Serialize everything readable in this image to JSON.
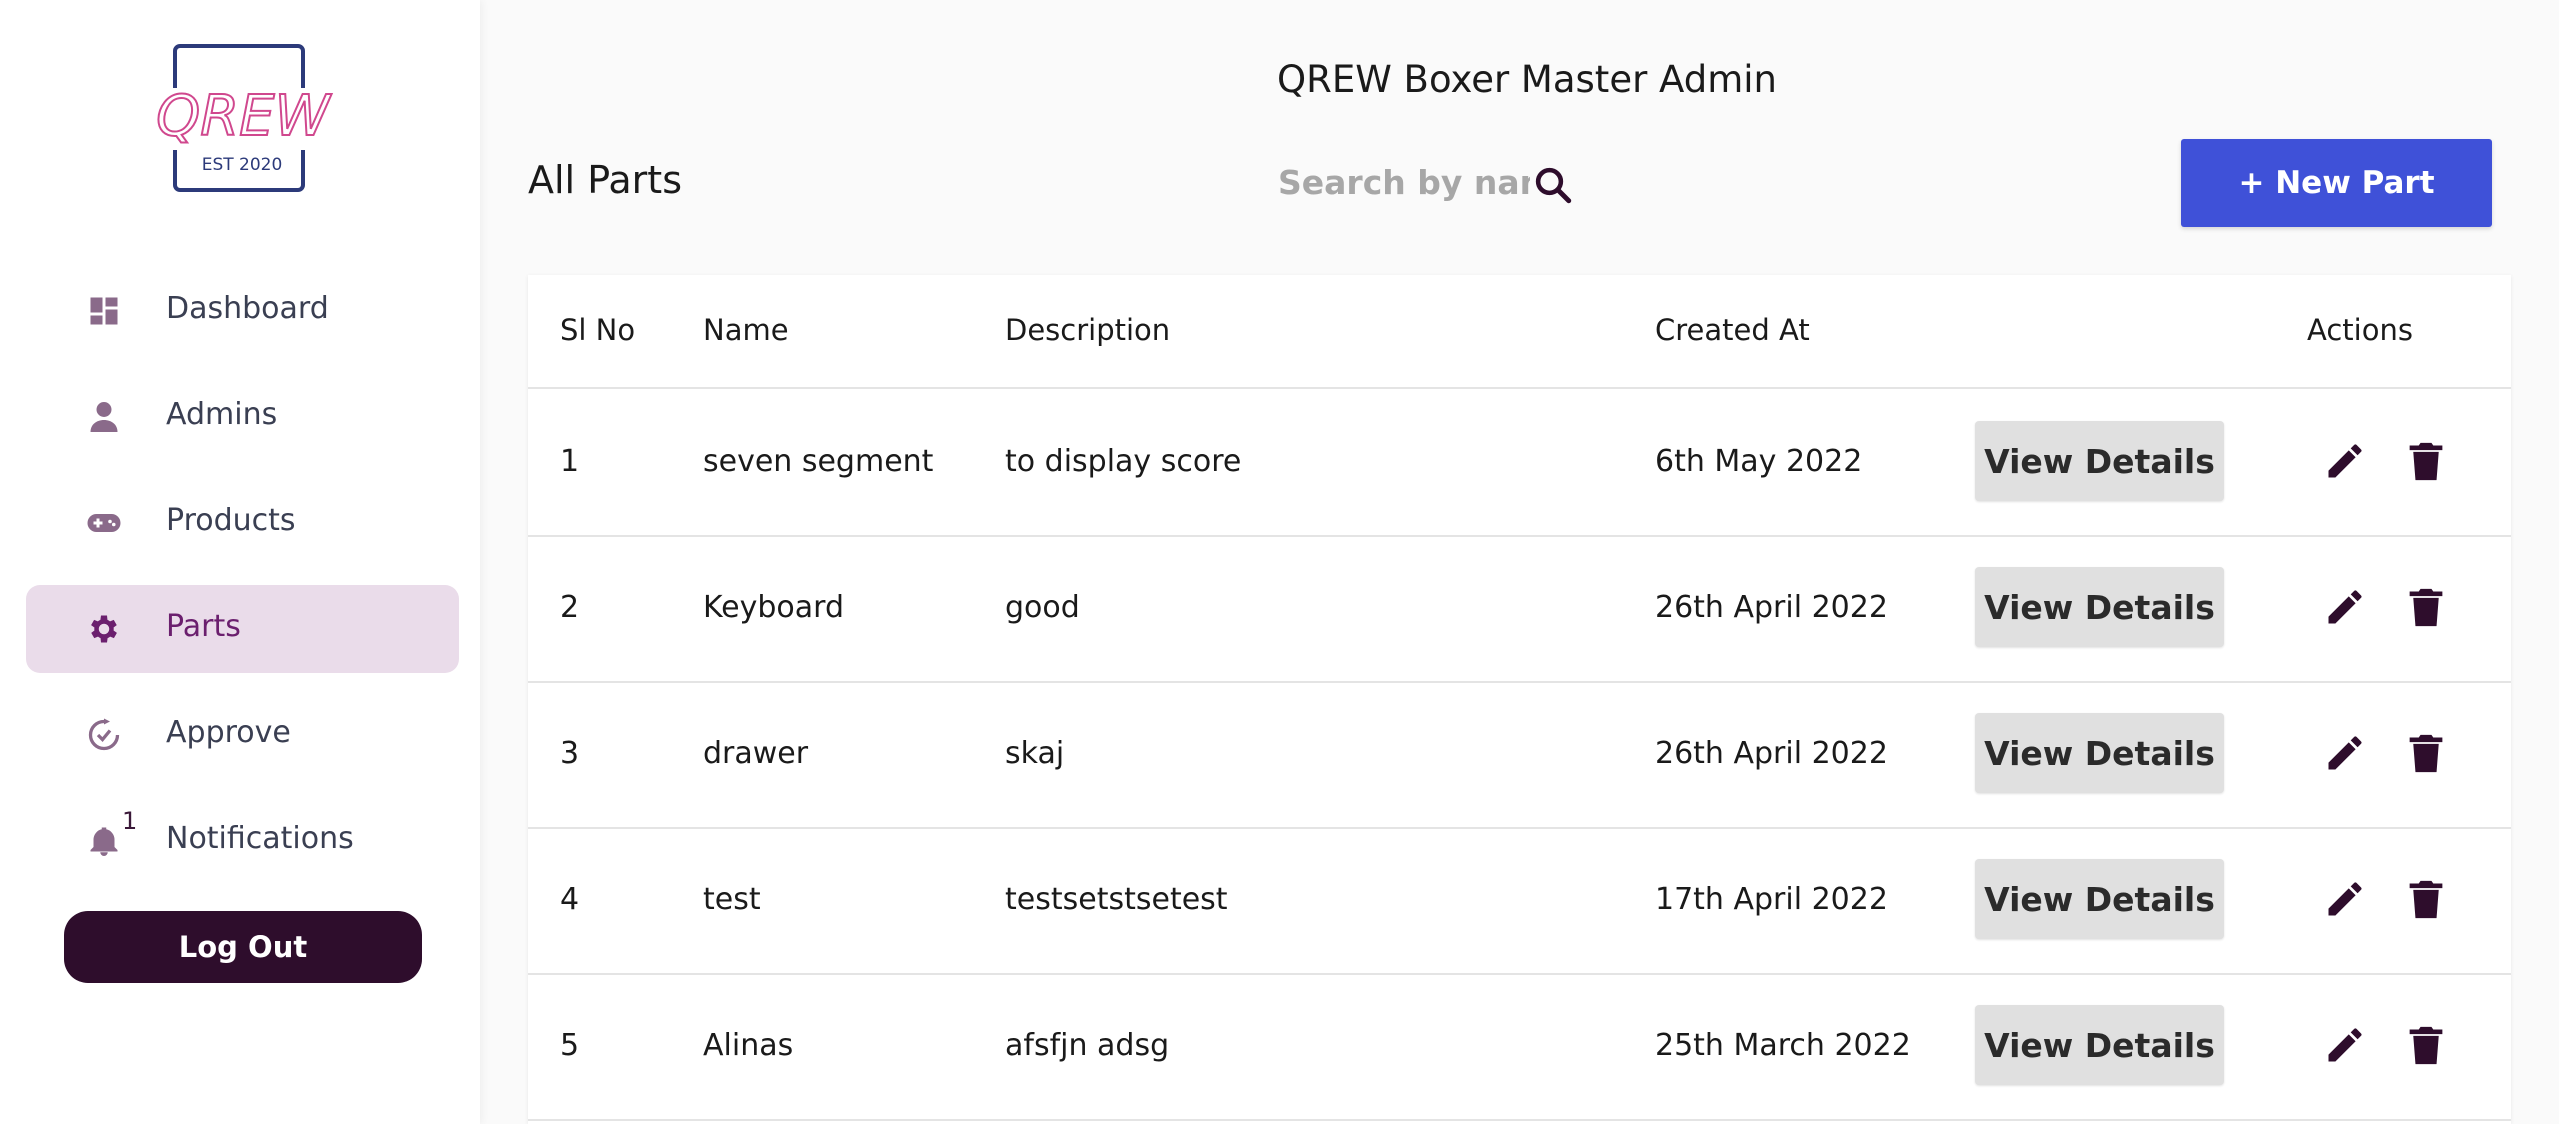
{
  "app": {
    "title": "QREW Boxer Master Admin"
  },
  "logo": {
    "text": "QREW",
    "subtitle": "EST 2020"
  },
  "sidebar": {
    "items": [
      {
        "label": "Dashboard",
        "icon": "dashboard-icon"
      },
      {
        "label": "Admins",
        "icon": "person-icon"
      },
      {
        "label": "Products",
        "icon": "gamepad-icon"
      },
      {
        "label": "Parts",
        "icon": "gear-icon",
        "active": true
      },
      {
        "label": "Approve",
        "icon": "approve-icon"
      },
      {
        "label": "Notifications",
        "icon": "bell-icon",
        "badge": "1"
      }
    ],
    "logout_label": "Log Out"
  },
  "page": {
    "title": "All Parts",
    "search_placeholder": "Search by name",
    "new_button_label": "+ New Part"
  },
  "table": {
    "columns": [
      "Sl No",
      "Name",
      "Description",
      "Created At",
      "Actions"
    ],
    "view_label": "View Details",
    "rows": [
      {
        "sl": "1",
        "name": "seven segment",
        "description": "to display score",
        "created_at": "6th May 2022"
      },
      {
        "sl": "2",
        "name": "Keyboard",
        "description": "good",
        "created_at": "26th April 2022"
      },
      {
        "sl": "3",
        "name": "drawer",
        "description": "skaj",
        "created_at": "26th April 2022"
      },
      {
        "sl": "4",
        "name": "test",
        "description": "testsetstsetest",
        "created_at": "17th April 2022"
      },
      {
        "sl": "5",
        "name": "Alinas",
        "description": "afsfjn adsg",
        "created_at": "25th March 2022"
      }
    ]
  },
  "colors": {
    "primary": "#3f51d8",
    "logout": "#2e0d2c",
    "active_bg": "#eadcea",
    "active_text": "#6b1f6e",
    "icon": "#2e0d2c"
  }
}
